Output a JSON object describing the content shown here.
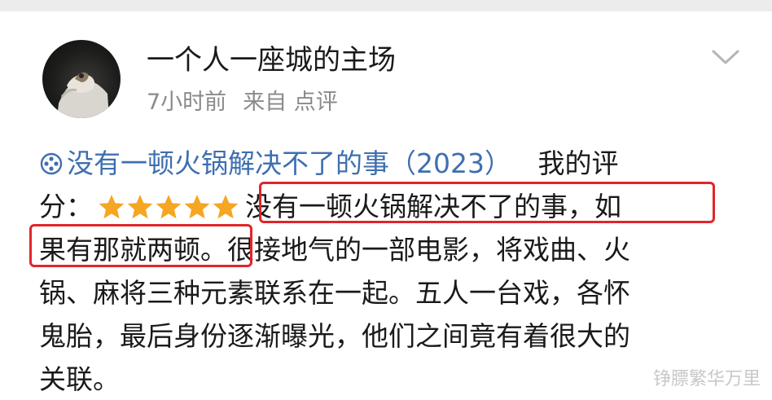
{
  "post": {
    "username": "一个人一座城的主场",
    "time": "7小时前",
    "source": "来自 点评"
  },
  "review": {
    "movie_title": "没有一顿火锅解决不了的事（2023）",
    "rating_label_1": "我的评",
    "rating_label_2": "分：",
    "rating_stars": 5,
    "highlight_1": "没有一顿火锅解决不了的事，如",
    "highlight_2": "果有那就两顿。",
    "line2_rest": "很接地气的一部电影，将戏曲、火",
    "line3": "锅、麻将三种元素联系在一起。五人一台戏，各怀",
    "line4": "鬼胎，最后身份逐渐曝光，他们之间竟有着很大的",
    "line5": "关联。"
  },
  "watermark": "铮膘繁华万里",
  "colors": {
    "link": "#3e6fb0",
    "star": "#f5a623",
    "highlight_border": "#e0252a",
    "meta_text": "#8a8a8a"
  },
  "icons": {
    "movie_link": "film-reel-icon",
    "expand": "chevron-down-icon"
  }
}
